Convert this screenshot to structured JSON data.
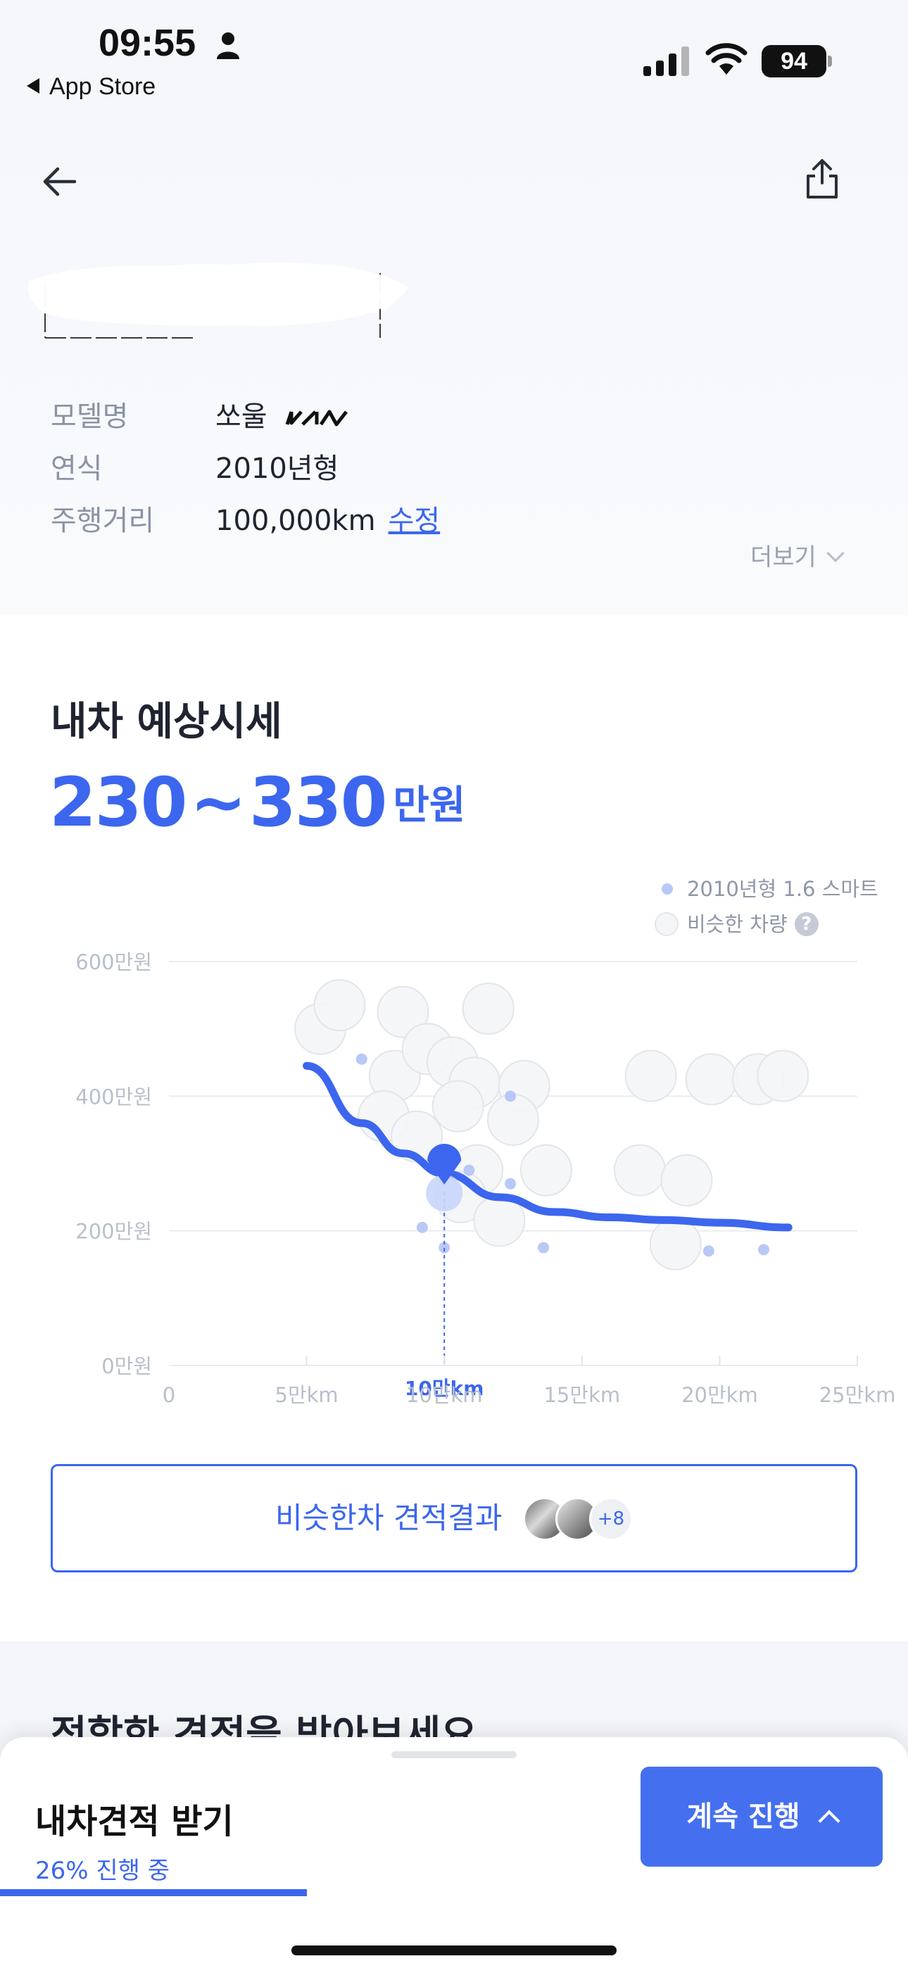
{
  "status_bar": {
    "time": "09:55",
    "back_to_app": "App Store",
    "battery": "94"
  },
  "car_info": {
    "rows": [
      {
        "label": "모델명",
        "value": "쏘울"
      },
      {
        "label": "연식",
        "value": "2010년형"
      },
      {
        "label": "주행거리",
        "value": "100,000km"
      }
    ],
    "edit_label": "수정",
    "brand_logo": "KIA",
    "more_label": "더보기"
  },
  "price": {
    "title": "내차 예상시세",
    "low": "230",
    "separator": "~",
    "high": "330",
    "unit": "만원"
  },
  "legend": {
    "series_label": "2010년형 1.6 스마트",
    "similar_label": "비슷한 차량",
    "help": "?"
  },
  "chart_data": {
    "type": "scatter",
    "x_unit": "만km",
    "y_unit": "만원",
    "xlim": [
      0,
      25
    ],
    "ylim": [
      0,
      600
    ],
    "x_ticks": [
      "0",
      "5만km",
      "10만km",
      "15만km",
      "20만km",
      "25만km"
    ],
    "x_tick_values": [
      0,
      5,
      10,
      15,
      20,
      25
    ],
    "y_ticks": [
      "0만원",
      "200만원",
      "400만원",
      "600만원"
    ],
    "y_tick_values": [
      0,
      200,
      400,
      600
    ],
    "grid": true,
    "series": [
      {
        "name": "2010년형 1.6 스마트",
        "color": "#b9c8f6",
        "points": [
          [
            7.0,
            455
          ],
          [
            9.2,
            205
          ],
          [
            10.0,
            175
          ],
          [
            12.4,
            400
          ],
          [
            12.4,
            270
          ],
          [
            13.6,
            175
          ],
          [
            19.6,
            170
          ],
          [
            21.6,
            172
          ],
          [
            10.9,
            290
          ]
        ]
      },
      {
        "name": "비슷한 차량",
        "color": "#f4f5f7",
        "points": [
          [
            5.5,
            500
          ],
          [
            6.2,
            535
          ],
          [
            8.5,
            525
          ],
          [
            11.6,
            530
          ],
          [
            8.2,
            430
          ],
          [
            9.4,
            470
          ],
          [
            10.3,
            450
          ],
          [
            11.1,
            420
          ],
          [
            12.9,
            415
          ],
          [
            12.5,
            365
          ],
          [
            10.5,
            385
          ],
          [
            7.8,
            370
          ],
          [
            9.0,
            340
          ],
          [
            11.2,
            290
          ],
          [
            10.6,
            250
          ],
          [
            12.0,
            215
          ],
          [
            13.7,
            290
          ],
          [
            17.5,
            430
          ],
          [
            19.7,
            425
          ],
          [
            21.4,
            425
          ],
          [
            22.3,
            430
          ],
          [
            17.1,
            290
          ],
          [
            18.8,
            275
          ],
          [
            18.4,
            180
          ]
        ]
      }
    ],
    "trend": {
      "color": "#3c66ee",
      "points": [
        [
          5.0,
          445
        ],
        [
          7.0,
          360
        ],
        [
          8.5,
          315
        ],
        [
          10.0,
          285
        ],
        [
          12.0,
          250
        ],
        [
          14.0,
          228
        ],
        [
          16.0,
          220
        ],
        [
          18.0,
          216
        ],
        [
          20.0,
          212
        ],
        [
          22.5,
          205
        ]
      ]
    },
    "marker": {
      "x": 10,
      "y": 300,
      "label": "10만km",
      "color": "#3c66ee"
    }
  },
  "similar_button": {
    "label": "비슷한차 견적결과",
    "more_count": "+8"
  },
  "next_section": {
    "heading": "적합한 견적을 받아보세요"
  },
  "bottom_sheet": {
    "title": "내차견적 받기",
    "progress_text": "26% 진행 중",
    "progress": 0.26,
    "continue_label": "계속 진행",
    "accent": "#3c66ee"
  }
}
